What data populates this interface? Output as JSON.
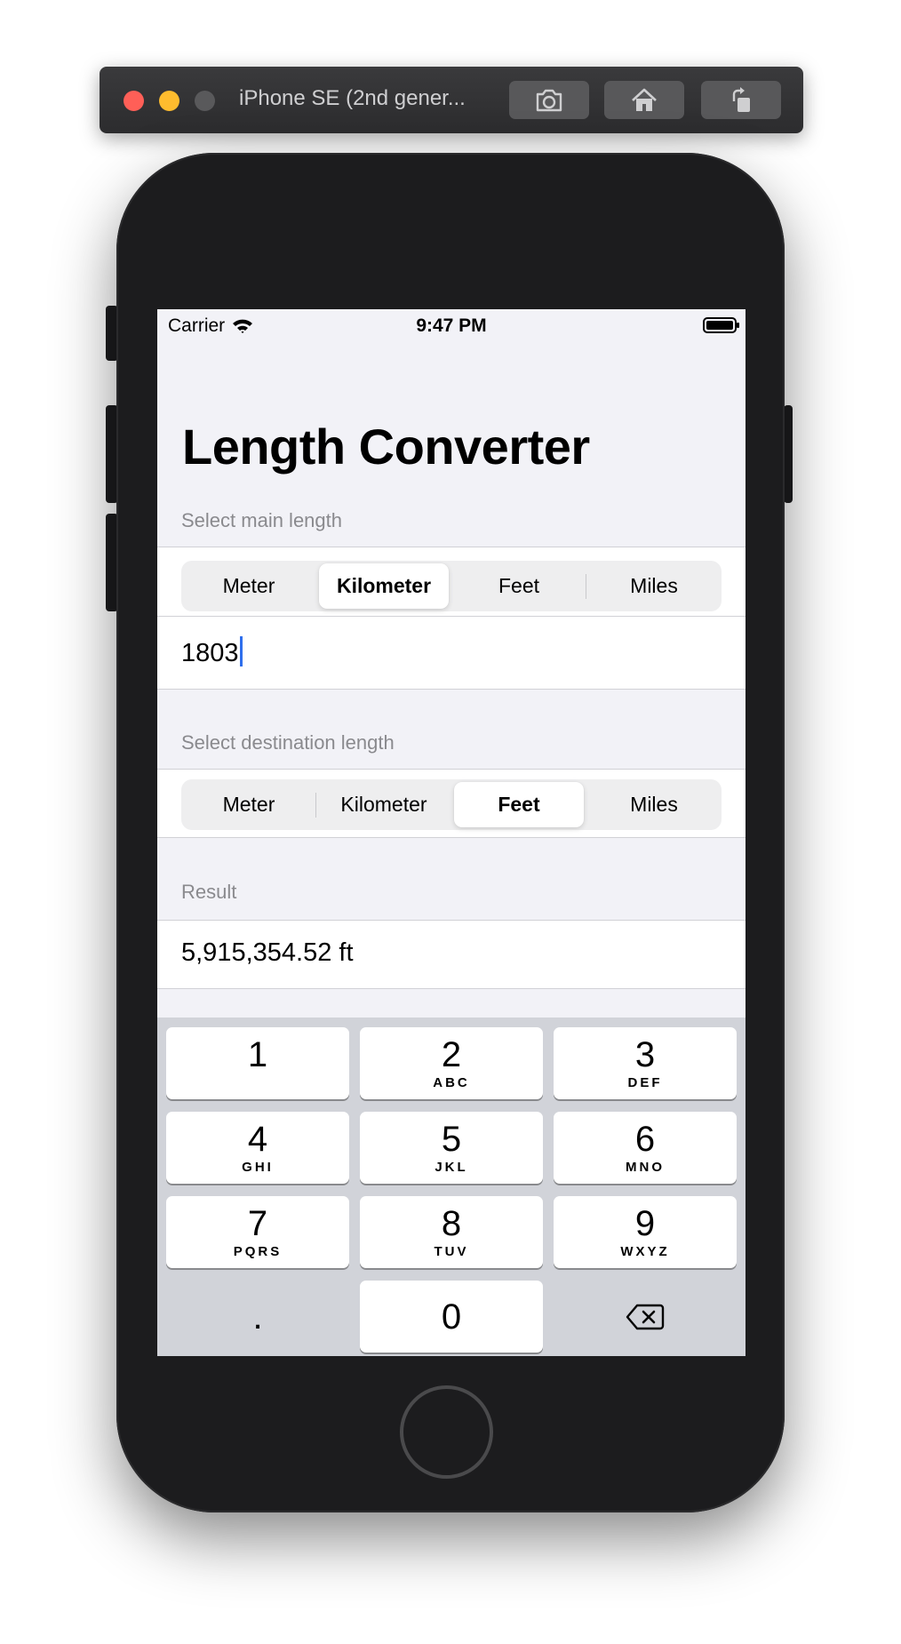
{
  "simulator": {
    "title": "iPhone SE (2nd gener..."
  },
  "status_bar": {
    "carrier": "Carrier",
    "time": "9:47 PM"
  },
  "app": {
    "title": "Length Converter",
    "main_section": {
      "label": "Select main length",
      "options": [
        "Meter",
        "Kilometer",
        "Feet",
        "Miles"
      ],
      "selected": "Kilometer"
    },
    "input": {
      "value": "1803"
    },
    "destination_section": {
      "label": "Select destination length",
      "options": [
        "Meter",
        "Kilometer",
        "Feet",
        "Miles"
      ],
      "selected": "Feet"
    },
    "result": {
      "label": "Result",
      "value": "5,915,354.52 ft"
    }
  },
  "keyboard": {
    "keys": [
      {
        "num": "1",
        "letters": ""
      },
      {
        "num": "2",
        "letters": "ABC"
      },
      {
        "num": "3",
        "letters": "DEF"
      },
      {
        "num": "4",
        "letters": "GHI"
      },
      {
        "num": "5",
        "letters": "JKL"
      },
      {
        "num": "6",
        "letters": "MNO"
      },
      {
        "num": "7",
        "letters": "PQRS"
      },
      {
        "num": "8",
        "letters": "TUV"
      },
      {
        "num": "9",
        "letters": "WXYZ"
      },
      {
        "num": ".",
        "letters": ""
      },
      {
        "num": "0",
        "letters": ""
      }
    ]
  },
  "colors": {
    "accent": "#2f6fed",
    "background": "#f2f2f7"
  }
}
